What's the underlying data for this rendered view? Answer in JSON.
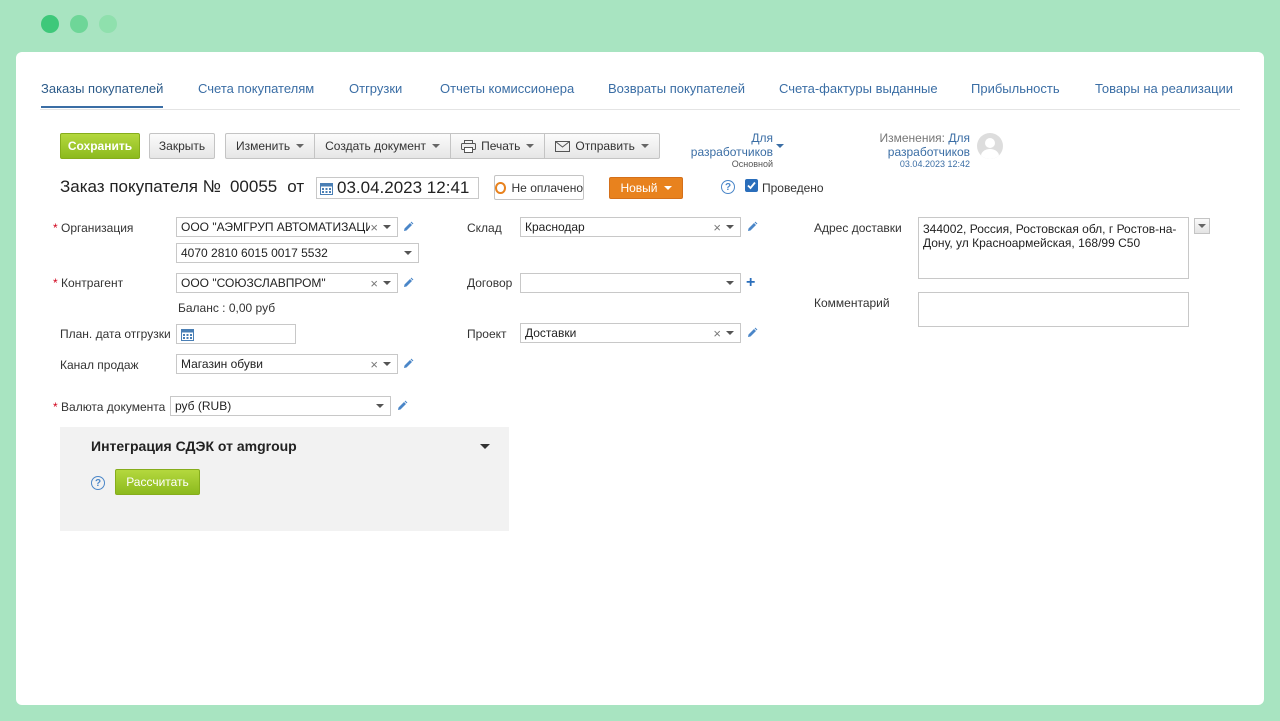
{
  "tabs": [
    {
      "label": "Заказы покупателей",
      "active": true
    },
    {
      "label": "Счета покупателям"
    },
    {
      "label": "Отгрузки"
    },
    {
      "label": "Отчеты комиссионера"
    },
    {
      "label": "Возвраты покупателей"
    },
    {
      "label": "Счета-фактуры выданные"
    },
    {
      "label": "Прибыльность"
    },
    {
      "label": "Товары на реализации"
    }
  ],
  "toolbar": {
    "save": "Сохранить",
    "close": "Закрыть",
    "edit": "Изменить",
    "create_doc": "Создать документ",
    "print": "Печать",
    "send": "Отправить",
    "developers": "Для разработчиков",
    "developers_sub": "Основной",
    "changes_label": "Изменения:",
    "changes_user": "Для разработчиков",
    "changes_date": "03.04.2023 12:42"
  },
  "header": {
    "title": "Заказ покупателя №",
    "number": "00055",
    "from": "от",
    "date": "03.04.2023 12:41",
    "payment_status": "Не оплачено",
    "status": "Новый",
    "posted_label": "Проведено",
    "posted": true
  },
  "form": {
    "organization_label": "Организация",
    "organization_value": "ООО \"АЭМГРУП АВТОМАТИЗАЦИ",
    "account_value": "4070 2810 6015 0017 5532",
    "counterparty_label": "Контрагент",
    "counterparty_value": "ООО \"СОЮЗСЛАВПРОМ\"",
    "balance": "Баланс : 0,00 руб",
    "ship_date_label": "План. дата отгрузки",
    "ship_date_value": "",
    "channel_label": "Канал продаж",
    "channel_value": "Магазин обуви",
    "currency_label": "Валюта документа",
    "currency_value": "руб (RUB)",
    "warehouse_label": "Склад",
    "warehouse_value": "Краснодар",
    "contract_label": "Договор",
    "contract_value": "",
    "project_label": "Проект",
    "project_value": "Доставки",
    "address_label": "Адрес доставки",
    "address_value": "344002, Россия, Ростовская обл, г Ростов-на-Дону, ул Красноармейская, 168/99 С50",
    "comment_label": "Комментарий",
    "comment_value": ""
  },
  "integration": {
    "title": "Интеграция СДЭК от amgroup",
    "calc_button": "Рассчитать"
  },
  "colors": {
    "background": "#a8e4c1",
    "accent_green": "#8cba1e",
    "status_orange": "#e8821e",
    "link_blue": "#3b6ea5"
  }
}
